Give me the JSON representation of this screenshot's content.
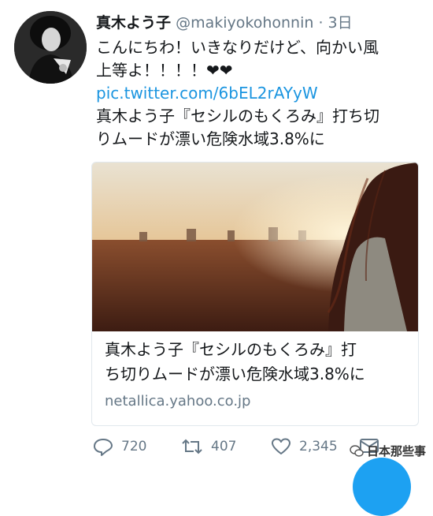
{
  "tweet": {
    "display_name": "真木よう子",
    "handle": "@makiyokohonnin",
    "separator": "·",
    "time": "3日",
    "text_lines": [
      "こんにちわ！いきなりだけど、向かい風",
      "上等よ！！！！❤❤"
    ],
    "link": "pic.twitter.com/6bEL2rAYyW",
    "text2_lines": [
      "真木よう子『セシルのもくろみ』打ち切",
      "りムードが漂い危険水域3.8%に"
    ]
  },
  "card": {
    "title_lines": [
      "真木よう子『セシルのもくろみ』打",
      "ち切りムードが漂い危険水域3.8%に"
    ],
    "domain": "netallica.yahoo.co.jp"
  },
  "actions": {
    "reply_count": "720",
    "retweet_count": "407",
    "like_count": "2,345"
  },
  "icons": {
    "reply": "reply-icon",
    "retweet": "retweet-icon",
    "like": "heart-icon",
    "dm": "mail-icon"
  },
  "watermark": {
    "text": "日本那些事"
  },
  "colors": {
    "link": "#1b95e0",
    "muted": "#657786",
    "fab": "#1da1f2"
  }
}
